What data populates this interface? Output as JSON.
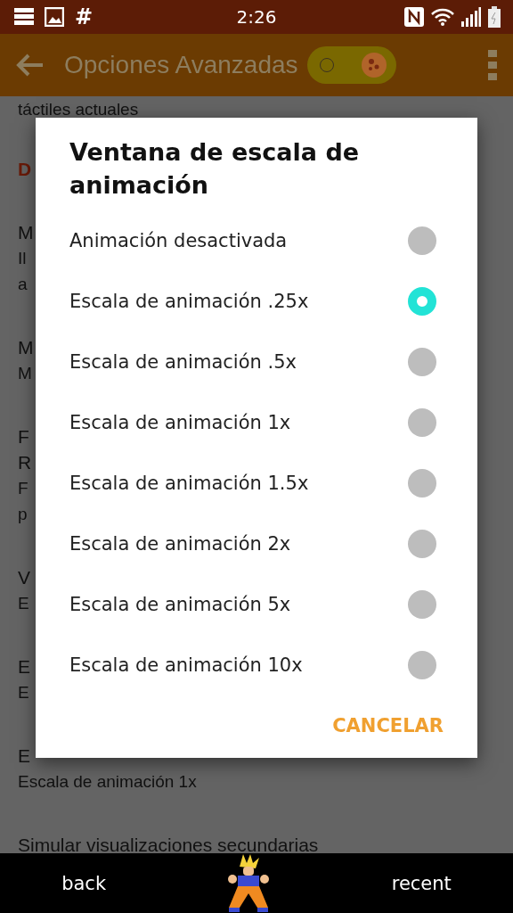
{
  "status_bar": {
    "hash": "#",
    "time": "2:26"
  },
  "toolbar": {
    "title": "Opciones Avanzadas",
    "switch_on": true
  },
  "background_list": [
    {
      "kind": "summary",
      "text": "táctiles actuales"
    },
    {
      "kind": "header",
      "text": "D"
    },
    {
      "kind": "title",
      "text": "M"
    },
    {
      "kind": "summary",
      "text": "Il"
    },
    {
      "kind": "summary",
      "text": "a"
    },
    {
      "kind": "title",
      "text": "M"
    },
    {
      "kind": "summary",
      "text": "M"
    },
    {
      "kind": "title",
      "text": "F"
    },
    {
      "kind": "title2",
      "text": "R"
    },
    {
      "kind": "summary",
      "text": "F"
    },
    {
      "kind": "summary",
      "text": "p"
    },
    {
      "kind": "title",
      "text": "V"
    },
    {
      "kind": "summary",
      "text": "E"
    },
    {
      "kind": "title",
      "text": "E"
    },
    {
      "kind": "summary",
      "text": "E"
    },
    {
      "kind": "title",
      "text": "E"
    },
    {
      "kind": "summary",
      "text": "Escala de animación 1x"
    },
    {
      "kind": "title",
      "text": "Simular visualizaciones secundarias"
    }
  ],
  "dialog": {
    "title": "Ventana de escala de animación",
    "options": [
      {
        "label": "Animación desactivada",
        "selected": false
      },
      {
        "label": "Escala de animación .25x",
        "selected": true
      },
      {
        "label": "Escala de animación .5x",
        "selected": false
      },
      {
        "label": "Escala de animación 1x",
        "selected": false
      },
      {
        "label": "Escala de animación 1.5x",
        "selected": false
      },
      {
        "label": "Escala de animación 2x",
        "selected": false
      },
      {
        "label": "Escala de animación 5x",
        "selected": false
      },
      {
        "label": "Escala de animación 10x",
        "selected": false
      }
    ],
    "button": "CANCELAR"
  },
  "nav_bar": {
    "back": "back",
    "recent": "recent"
  }
}
